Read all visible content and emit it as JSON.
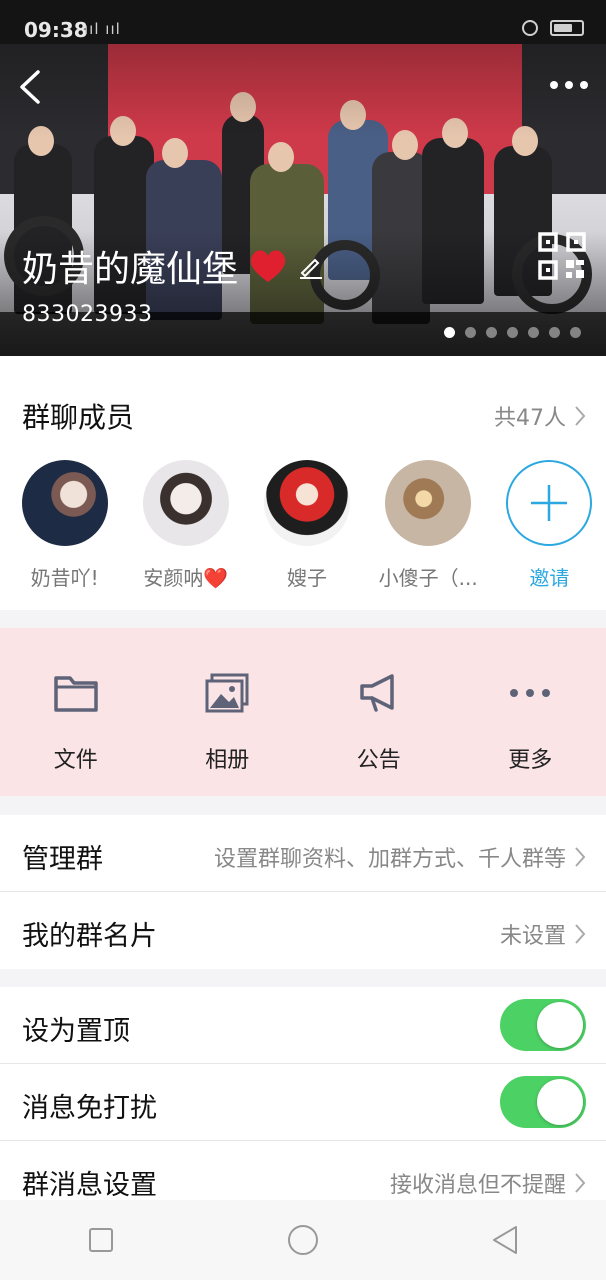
{
  "status_bar": {
    "time": "09:38",
    "signal": "ııl ııl"
  },
  "header": {
    "group_name": "奶昔的魔仙堡",
    "group_id": "833023933",
    "carousel_total": 7,
    "carousel_active_index": 0
  },
  "members": {
    "title": "群聊成员",
    "count_label": "共47人",
    "items": [
      {
        "name": "奶昔吖!"
      },
      {
        "name": "安颜呐❤️"
      },
      {
        "name": "嫂子"
      },
      {
        "name": "小傻子（..."
      }
    ],
    "invite_label": "邀请"
  },
  "tools": [
    {
      "label": "文件",
      "icon": "folder-icon"
    },
    {
      "label": "相册",
      "icon": "photo-album-icon"
    },
    {
      "label": "公告",
      "icon": "megaphone-icon"
    },
    {
      "label": "更多",
      "icon": "more-dots-icon"
    }
  ],
  "settings": {
    "manage": {
      "label": "管理群",
      "value": "设置群聊资料、加群方式、千人群等"
    },
    "card": {
      "label": "我的群名片",
      "value": "未设置"
    },
    "pin": {
      "label": "设为置顶",
      "on": true
    },
    "mute": {
      "label": "消息免打扰",
      "on": true
    },
    "message": {
      "label": "群消息设置",
      "value": "接收消息但不提醒"
    }
  },
  "colors": {
    "accent": "#2ca8e0",
    "toggle_on": "#4cd164",
    "tools_bg": "#fbe4e6",
    "heart": "#e0202e"
  }
}
